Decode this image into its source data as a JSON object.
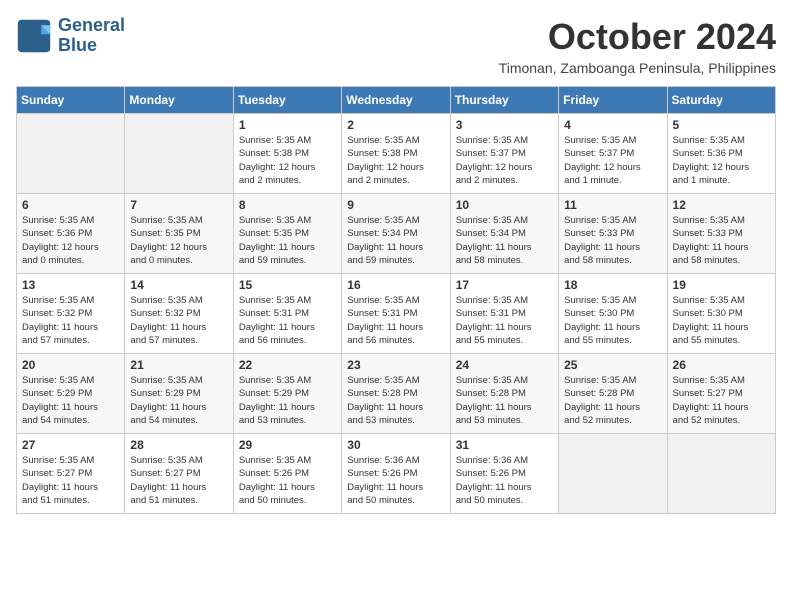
{
  "logo": {
    "text_line1": "General",
    "text_line2": "Blue"
  },
  "title": {
    "month_year": "October 2024",
    "location": "Timonan, Zamboanga Peninsula, Philippines"
  },
  "days_of_week": [
    "Sunday",
    "Monday",
    "Tuesday",
    "Wednesday",
    "Thursday",
    "Friday",
    "Saturday"
  ],
  "weeks": [
    [
      {
        "day": "",
        "details": ""
      },
      {
        "day": "",
        "details": ""
      },
      {
        "day": "1",
        "details": "Sunrise: 5:35 AM\nSunset: 5:38 PM\nDaylight: 12 hours\nand 2 minutes."
      },
      {
        "day": "2",
        "details": "Sunrise: 5:35 AM\nSunset: 5:38 PM\nDaylight: 12 hours\nand 2 minutes."
      },
      {
        "day": "3",
        "details": "Sunrise: 5:35 AM\nSunset: 5:37 PM\nDaylight: 12 hours\nand 2 minutes."
      },
      {
        "day": "4",
        "details": "Sunrise: 5:35 AM\nSunset: 5:37 PM\nDaylight: 12 hours\nand 1 minute."
      },
      {
        "day": "5",
        "details": "Sunrise: 5:35 AM\nSunset: 5:36 PM\nDaylight: 12 hours\nand 1 minute."
      }
    ],
    [
      {
        "day": "6",
        "details": "Sunrise: 5:35 AM\nSunset: 5:36 PM\nDaylight: 12 hours\nand 0 minutes."
      },
      {
        "day": "7",
        "details": "Sunrise: 5:35 AM\nSunset: 5:35 PM\nDaylight: 12 hours\nand 0 minutes."
      },
      {
        "day": "8",
        "details": "Sunrise: 5:35 AM\nSunset: 5:35 PM\nDaylight: 11 hours\nand 59 minutes."
      },
      {
        "day": "9",
        "details": "Sunrise: 5:35 AM\nSunset: 5:34 PM\nDaylight: 11 hours\nand 59 minutes."
      },
      {
        "day": "10",
        "details": "Sunrise: 5:35 AM\nSunset: 5:34 PM\nDaylight: 11 hours\nand 58 minutes."
      },
      {
        "day": "11",
        "details": "Sunrise: 5:35 AM\nSunset: 5:33 PM\nDaylight: 11 hours\nand 58 minutes."
      },
      {
        "day": "12",
        "details": "Sunrise: 5:35 AM\nSunset: 5:33 PM\nDaylight: 11 hours\nand 58 minutes."
      }
    ],
    [
      {
        "day": "13",
        "details": "Sunrise: 5:35 AM\nSunset: 5:32 PM\nDaylight: 11 hours\nand 57 minutes."
      },
      {
        "day": "14",
        "details": "Sunrise: 5:35 AM\nSunset: 5:32 PM\nDaylight: 11 hours\nand 57 minutes."
      },
      {
        "day": "15",
        "details": "Sunrise: 5:35 AM\nSunset: 5:31 PM\nDaylight: 11 hours\nand 56 minutes."
      },
      {
        "day": "16",
        "details": "Sunrise: 5:35 AM\nSunset: 5:31 PM\nDaylight: 11 hours\nand 56 minutes."
      },
      {
        "day": "17",
        "details": "Sunrise: 5:35 AM\nSunset: 5:31 PM\nDaylight: 11 hours\nand 55 minutes."
      },
      {
        "day": "18",
        "details": "Sunrise: 5:35 AM\nSunset: 5:30 PM\nDaylight: 11 hours\nand 55 minutes."
      },
      {
        "day": "19",
        "details": "Sunrise: 5:35 AM\nSunset: 5:30 PM\nDaylight: 11 hours\nand 55 minutes."
      }
    ],
    [
      {
        "day": "20",
        "details": "Sunrise: 5:35 AM\nSunset: 5:29 PM\nDaylight: 11 hours\nand 54 minutes."
      },
      {
        "day": "21",
        "details": "Sunrise: 5:35 AM\nSunset: 5:29 PM\nDaylight: 11 hours\nand 54 minutes."
      },
      {
        "day": "22",
        "details": "Sunrise: 5:35 AM\nSunset: 5:29 PM\nDaylight: 11 hours\nand 53 minutes."
      },
      {
        "day": "23",
        "details": "Sunrise: 5:35 AM\nSunset: 5:28 PM\nDaylight: 11 hours\nand 53 minutes."
      },
      {
        "day": "24",
        "details": "Sunrise: 5:35 AM\nSunset: 5:28 PM\nDaylight: 11 hours\nand 53 minutes."
      },
      {
        "day": "25",
        "details": "Sunrise: 5:35 AM\nSunset: 5:28 PM\nDaylight: 11 hours\nand 52 minutes."
      },
      {
        "day": "26",
        "details": "Sunrise: 5:35 AM\nSunset: 5:27 PM\nDaylight: 11 hours\nand 52 minutes."
      }
    ],
    [
      {
        "day": "27",
        "details": "Sunrise: 5:35 AM\nSunset: 5:27 PM\nDaylight: 11 hours\nand 51 minutes."
      },
      {
        "day": "28",
        "details": "Sunrise: 5:35 AM\nSunset: 5:27 PM\nDaylight: 11 hours\nand 51 minutes."
      },
      {
        "day": "29",
        "details": "Sunrise: 5:35 AM\nSunset: 5:26 PM\nDaylight: 11 hours\nand 50 minutes."
      },
      {
        "day": "30",
        "details": "Sunrise: 5:36 AM\nSunset: 5:26 PM\nDaylight: 11 hours\nand 50 minutes."
      },
      {
        "day": "31",
        "details": "Sunrise: 5:36 AM\nSunset: 5:26 PM\nDaylight: 11 hours\nand 50 minutes."
      },
      {
        "day": "",
        "details": ""
      },
      {
        "day": "",
        "details": ""
      }
    ]
  ]
}
